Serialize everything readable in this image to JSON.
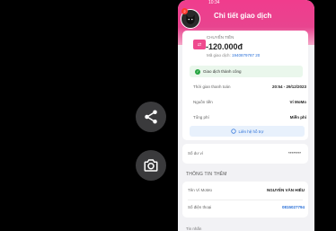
{
  "screen": {
    "title": "Chi tiết giao dịch",
    "status_time": "10:34",
    "avatar_badge": "2"
  },
  "transaction": {
    "type_label": "CHUYỂN TIỀN",
    "amount": "-120.000đ",
    "code_label": "Mã giao dịch:",
    "code_value": "1940879787 20",
    "status_text": "Giao dịch thành công",
    "fields": [
      {
        "label": "Thời gian thanh toán",
        "value": "20:54 - 29/12/2023"
      },
      {
        "label": "Nguồn tiền",
        "value": "Ví MoMo"
      },
      {
        "label": "Tổng phí",
        "value": "Miễn phí"
      }
    ],
    "support_label": "Liên hệ hỗ trợ"
  },
  "reference": {
    "label": "Số dư ví",
    "value": "********"
  },
  "extra": {
    "section_title": "THÔNG TIN THÊM",
    "rows": [
      {
        "label": "Tên Ví MoMo",
        "value": "NGUYỄN VĂN HIẾU"
      },
      {
        "label": "Số điện thoại",
        "value": "0815027794"
      }
    ]
  },
  "footer": {
    "label": "Tin nhắn"
  },
  "colors": {
    "brand_pink": "#ef4a8e",
    "link_blue": "#2a70d8",
    "success_green": "#26a541"
  },
  "icons": {
    "share": "share-icon",
    "camera": "camera-icon"
  }
}
